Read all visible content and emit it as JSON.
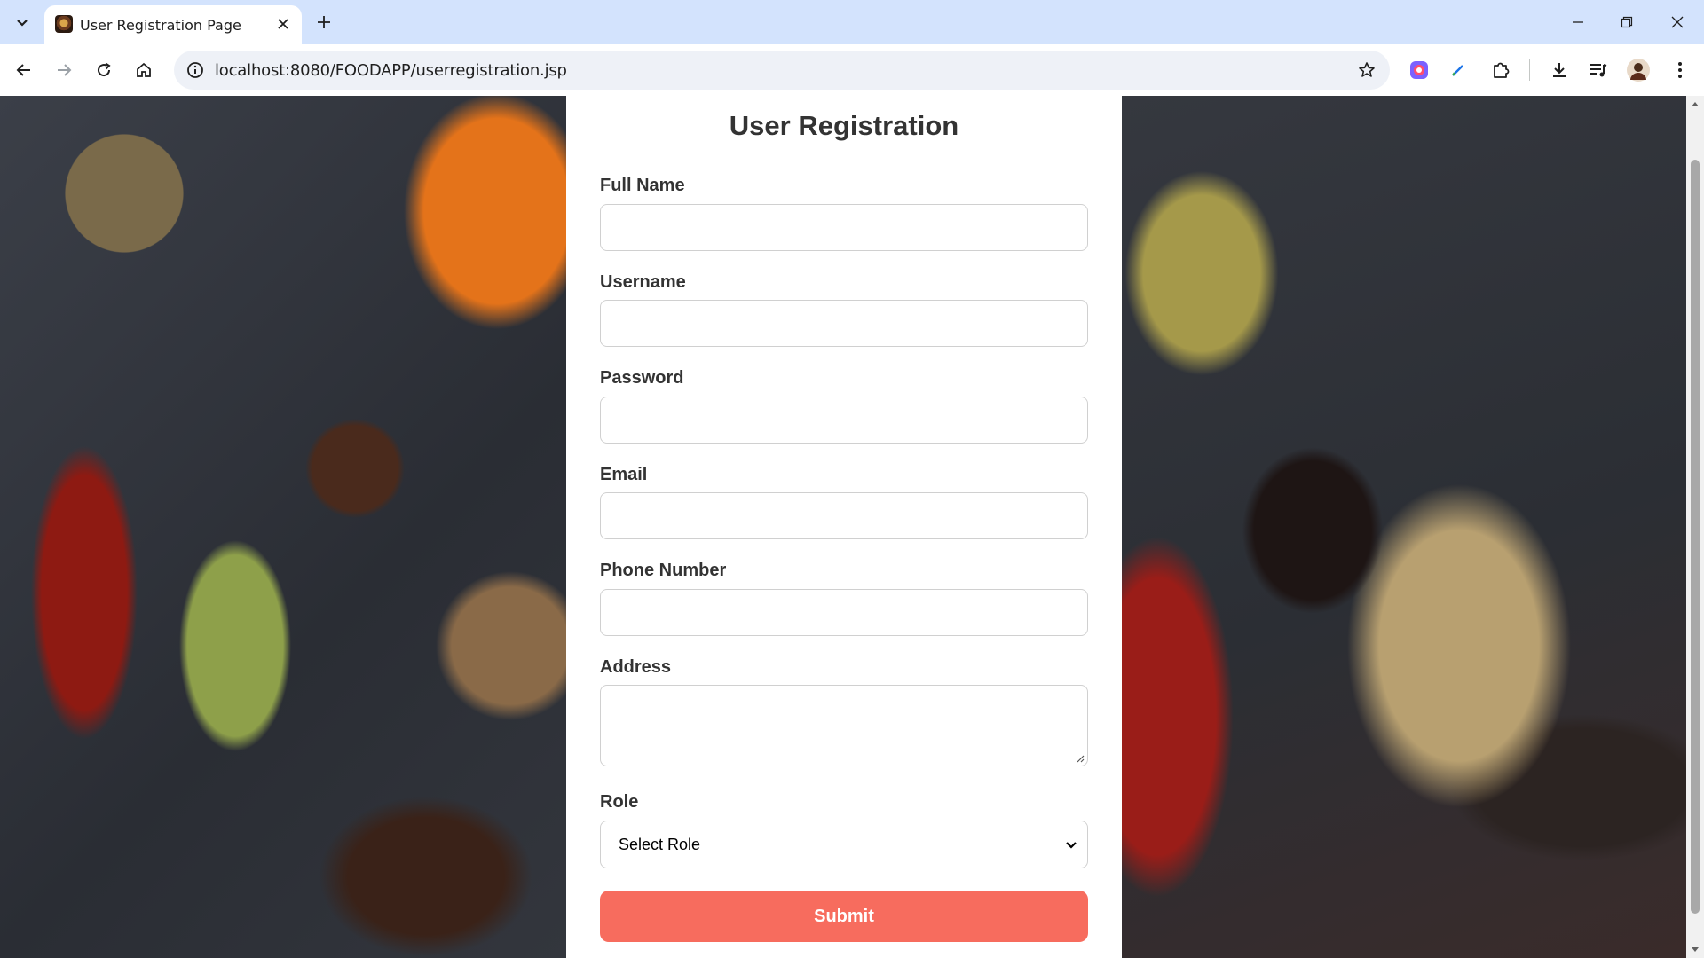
{
  "browser": {
    "tab_title": "User Registration Page",
    "url": "localhost:8080/FOODAPP/userregistration.jsp"
  },
  "form": {
    "title": "User Registration",
    "fields": [
      {
        "label": "Full Name",
        "value": ""
      },
      {
        "label": "Username",
        "value": ""
      },
      {
        "label": "Password",
        "value": ""
      },
      {
        "label": "Email",
        "value": ""
      },
      {
        "label": "Phone Number",
        "value": ""
      },
      {
        "label": "Address",
        "value": ""
      }
    ],
    "role": {
      "label": "Role",
      "selected": "Select Role"
    },
    "submit_label": "Submit"
  },
  "colors": {
    "submit": "#f76c5e",
    "tabbar": "#d3e3fd"
  }
}
